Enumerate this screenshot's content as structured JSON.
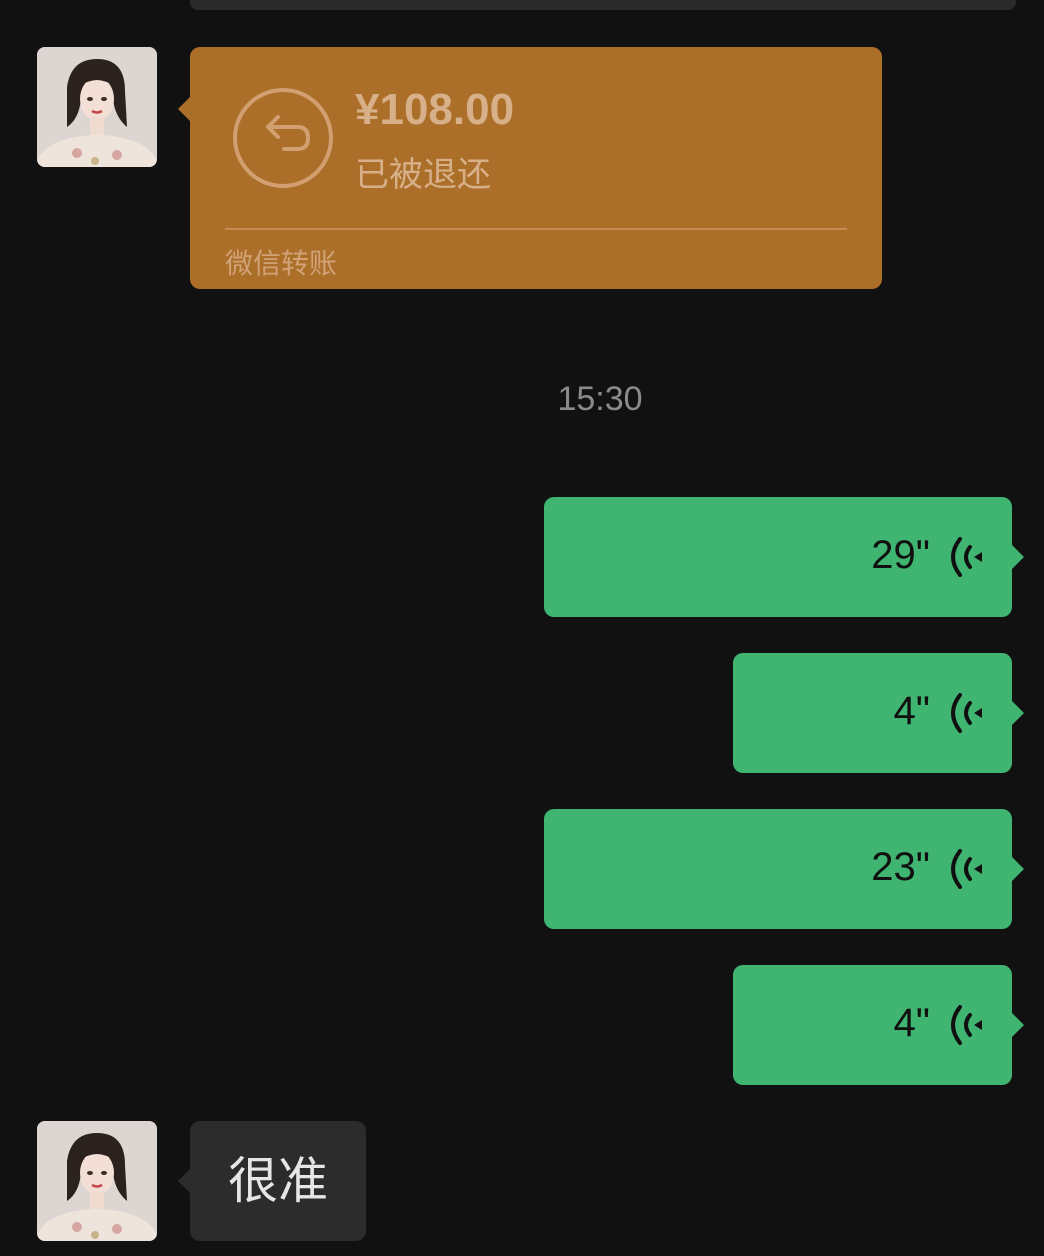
{
  "colors": {
    "background": "#111111",
    "transfer_card": "#ac6f2a",
    "voice_bubble": "#3fb571",
    "incoming_bubble": "#2c2c2c"
  },
  "messages": {
    "transfer": {
      "amount": "¥108.00",
      "status": "已被退还",
      "footer": "微信转账",
      "icon": "refund-arrow-icon"
    },
    "timestamp": "15:30",
    "voice": [
      {
        "duration": "29\"",
        "icon": "voice-wave-icon"
      },
      {
        "duration": "4\"",
        "icon": "voice-wave-icon"
      },
      {
        "duration": "23\"",
        "icon": "voice-wave-icon"
      },
      {
        "duration": "4\"",
        "icon": "voice-wave-icon"
      }
    ],
    "text": {
      "content": "很准"
    }
  }
}
